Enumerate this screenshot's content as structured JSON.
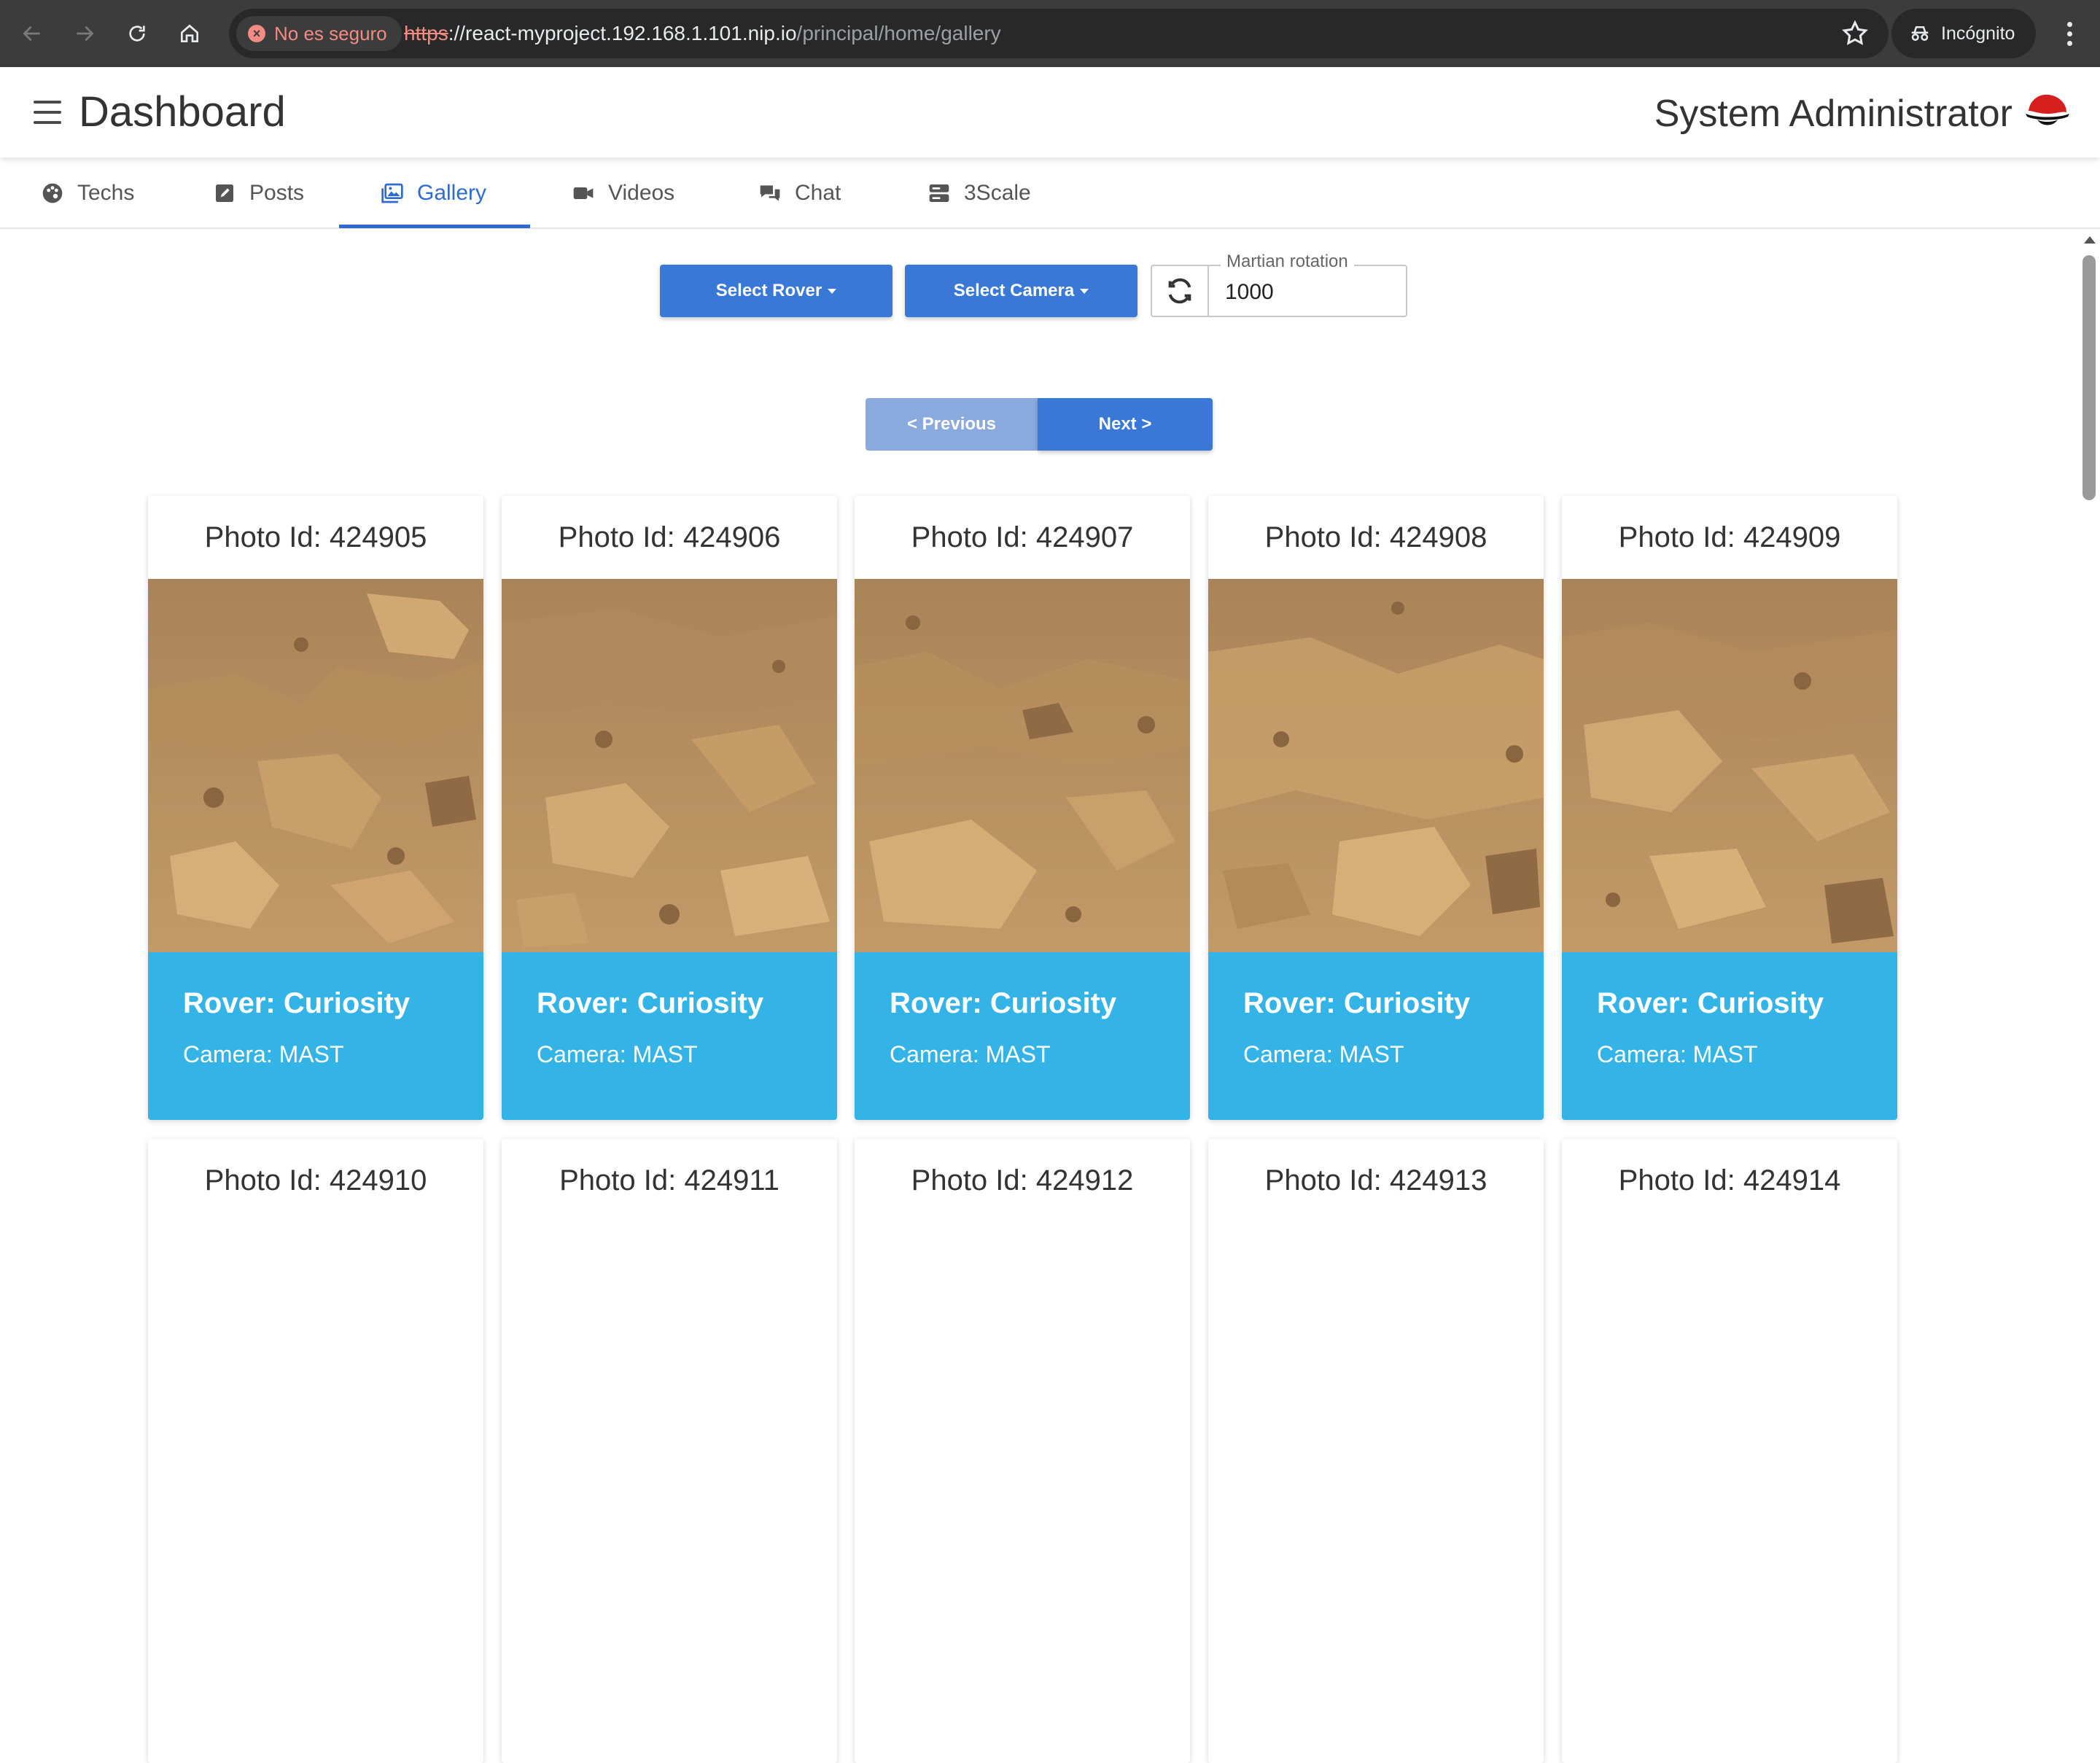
{
  "browser": {
    "security_label": "No es seguro",
    "url_scheme": "https",
    "url_host": "://react-myproject.192.168.1.101.nip.io",
    "url_path": "/principal/home/gallery",
    "incognito_label": "Incógnito"
  },
  "header": {
    "title": "Dashboard",
    "user_name": "System Administrator"
  },
  "tabs": [
    {
      "label": "Techs",
      "icon": "palette-icon"
    },
    {
      "label": "Posts",
      "icon": "edit-icon"
    },
    {
      "label": "Gallery",
      "icon": "images-icon",
      "active": true
    },
    {
      "label": "Videos",
      "icon": "video-icon"
    },
    {
      "label": "Chat",
      "icon": "comments-icon"
    },
    {
      "label": "3Scale",
      "icon": "server-icon"
    }
  ],
  "controls": {
    "select_rover_label": "Select Rover",
    "select_camera_label": "Select Camera",
    "rotation_label": "Martian rotation",
    "rotation_value": "1000",
    "previous_label": "< Previous",
    "next_label": "Next >"
  },
  "cards": [
    {
      "title": "Photo Id: 424905",
      "rover": "Rover: Curiosity",
      "camera": "Camera: MAST"
    },
    {
      "title": "Photo Id: 424906",
      "rover": "Rover: Curiosity",
      "camera": "Camera: MAST"
    },
    {
      "title": "Photo Id: 424907",
      "rover": "Rover: Curiosity",
      "camera": "Camera: MAST"
    },
    {
      "title": "Photo Id: 424908",
      "rover": "Rover: Curiosity",
      "camera": "Camera: MAST"
    },
    {
      "title": "Photo Id: 424909",
      "rover": "Rover: Curiosity",
      "camera": "Camera: MAST"
    },
    {
      "title": "Photo Id: 424910"
    },
    {
      "title": "Photo Id: 424911"
    },
    {
      "title": "Photo Id: 424912"
    },
    {
      "title": "Photo Id: 424913"
    },
    {
      "title": "Photo Id: 424914"
    }
  ],
  "colors": {
    "primary": "#3a78d8",
    "card_info": "#34b4e6",
    "tab_active": "#2e6bd1"
  }
}
